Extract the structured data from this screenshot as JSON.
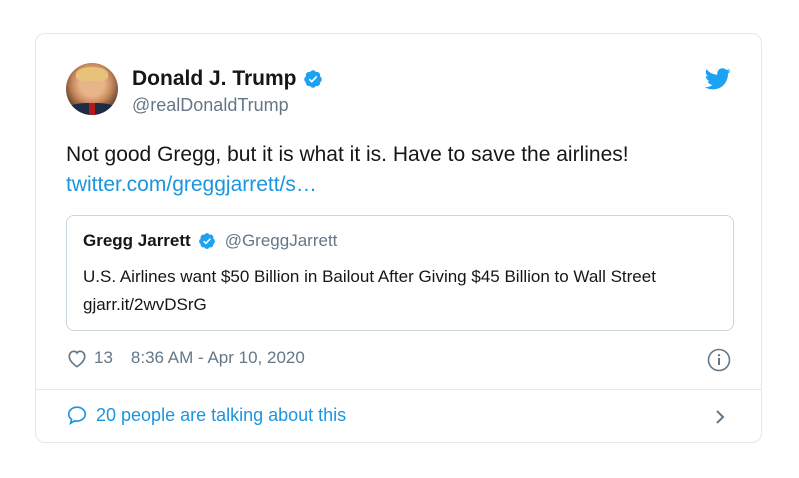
{
  "tweet": {
    "author_name": "Donald J. Trump",
    "author_handle": "@realDonaldTrump",
    "text": "Not good Gregg, but it is what it is. Have to save the airlines!",
    "link": "twitter.com/greggjarrett/s…",
    "likes": "13",
    "timestamp": "8:36 AM - Apr 10, 2020",
    "talking": "20 people are talking about this"
  },
  "quoted": {
    "name": "Gregg Jarrett",
    "handle": "@GreggJarrett",
    "text": "U.S. Airlines want $50 Billion in Bailout After Giving $45 Billion to Wall Street gjarr.it/2wvDSrG"
  },
  "icons": {
    "verified": "verified-badge-icon",
    "brand": "twitter-bird-icon",
    "like": "heart-icon",
    "info": "info-icon",
    "reply": "speech-bubble-icon",
    "chevron": "chevron-right-icon"
  },
  "colors": {
    "accent": "#1da1f2",
    "link": "#1b95e0",
    "muted": "#657786",
    "text": "#14171a",
    "border": "#e1e8ed"
  }
}
